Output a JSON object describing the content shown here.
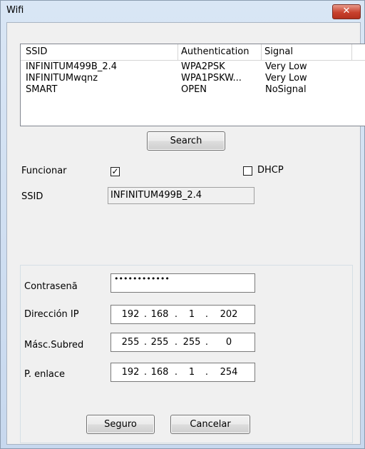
{
  "window": {
    "title": "Wifi",
    "close_glyph": "✕"
  },
  "networks": {
    "columns": [
      "SSID",
      "Authentication",
      "Signal"
    ],
    "rows": [
      {
        "ssid": "INFINITUM499B_2.4",
        "auth": "WPA2PSK",
        "signal": "Very Low"
      },
      {
        "ssid": "INFINITUMwqnz",
        "auth": "WPA1PSKW...",
        "signal": "Very Low"
      },
      {
        "ssid": "SMART",
        "auth": "OPEN",
        "signal": "NoSignal"
      }
    ]
  },
  "search_label": "Search",
  "funcionar": {
    "label": "Funcionar",
    "checked": true,
    "mark": "✓"
  },
  "dhcp": {
    "label": "DHCP",
    "checked": false
  },
  "ssid_field": {
    "label": "SSID",
    "value": "INFINITUM499B_2.4"
  },
  "password": {
    "label": "Contrasenã",
    "value": "••••••••••••"
  },
  "ip": {
    "label": "Dirección IP",
    "parts": [
      "192",
      "168",
      "1",
      "202"
    ]
  },
  "mask": {
    "label": "Másc.Subred",
    "parts": [
      "255",
      "255",
      "255",
      "0"
    ]
  },
  "gateway": {
    "label": "P. enlace",
    "parts": [
      "192",
      "168",
      "1",
      "254"
    ]
  },
  "ip_separator": ".",
  "buttons": {
    "ok": "Seguro",
    "cancel": "Cancelar"
  }
}
